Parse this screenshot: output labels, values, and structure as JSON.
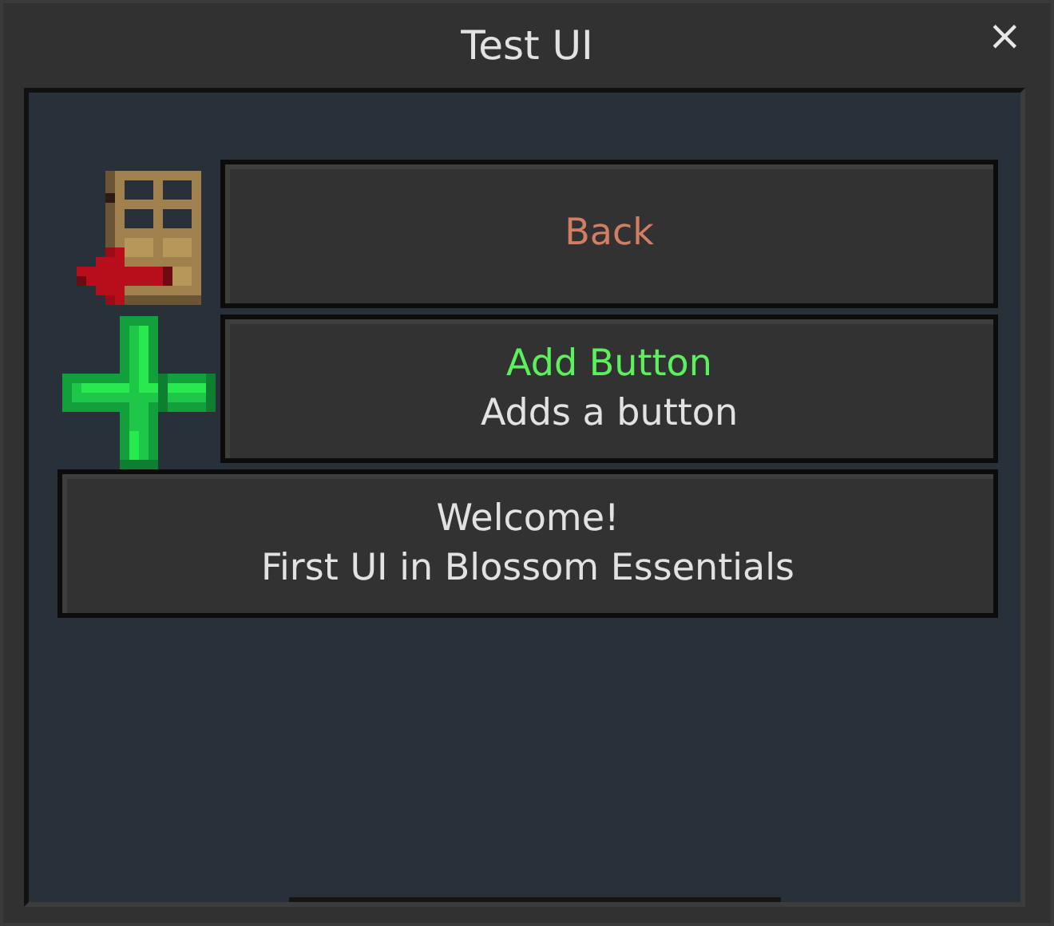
{
  "window": {
    "title": "Test UI",
    "close": "×"
  },
  "buttons": [
    {
      "kind": "door",
      "lines": [
        {
          "text": "Back",
          "color": "#d27e63"
        }
      ]
    },
    {
      "kind": "plus",
      "lines": [
        {
          "text": "Add Button",
          "color": "#5cf05c"
        },
        {
          "text": "Adds a button",
          "color": "#e2e2e2"
        }
      ]
    },
    {
      "kind": "text",
      "lines": [
        {
          "text": "Welcome!",
          "color": "#e2e2e2"
        },
        {
          "text": "First UI in Blossom Essentials",
          "color": "#e2e2e2"
        }
      ]
    }
  ]
}
